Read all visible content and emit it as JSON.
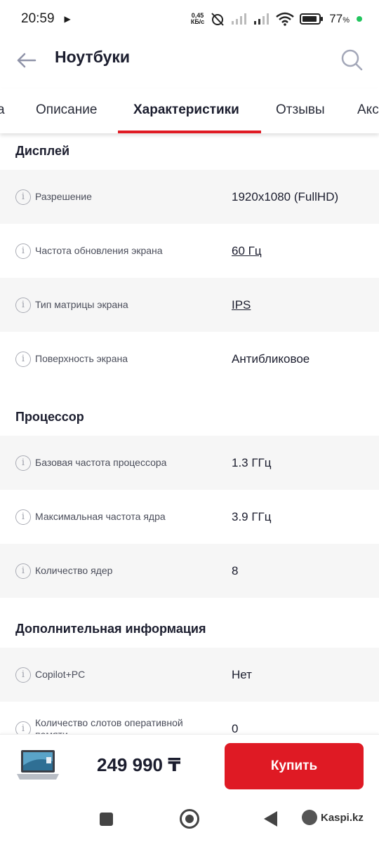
{
  "status_bar": {
    "time": "20:59",
    "net_speed_value": "0,45",
    "net_speed_unit": "КБ/с",
    "battery_percent": "77",
    "battery_percent_sign": "%"
  },
  "header": {
    "title": "Ноутбуки"
  },
  "tabs": [
    {
      "label": "а"
    },
    {
      "label": "Описание"
    },
    {
      "label": "Характеристики"
    },
    {
      "label": "Отзывы"
    },
    {
      "label": "Акс"
    }
  ],
  "sections": [
    {
      "title": "Дисплей",
      "rows": [
        {
          "label": "Разрешение",
          "value": "1920x1080 (FullHD)"
        },
        {
          "label": "Частота обновления экрана",
          "value": "60 Гц"
        },
        {
          "label": "Тип матрицы экрана",
          "value": "IPS"
        },
        {
          "label": "Поверхность экрана",
          "value": "Антибликовое"
        }
      ]
    },
    {
      "title": "Процессор",
      "rows": [
        {
          "label": "Базовая частота процессора",
          "value": "1.3 ГГц"
        },
        {
          "label": "Максимальная частота ядра",
          "value": "3.9 ГГц"
        },
        {
          "label": "Количество ядер",
          "value": "8"
        }
      ]
    },
    {
      "title": "Дополнительная информация",
      "rows": [
        {
          "label": "Copilot+PC",
          "value": "Нет"
        },
        {
          "label": "Количество слотов оперативной памяти",
          "value": "0"
        }
      ]
    }
  ],
  "info_icon_glyph": "i",
  "buy_bar": {
    "price": "249 990 ₸",
    "buy_label": "Купить"
  },
  "watermark": {
    "text": "Kaspi.kz"
  },
  "colors": {
    "accent_red": "#df1a24",
    "text_dark": "#1b1d2e",
    "row_shade": "#f6f6f6"
  }
}
